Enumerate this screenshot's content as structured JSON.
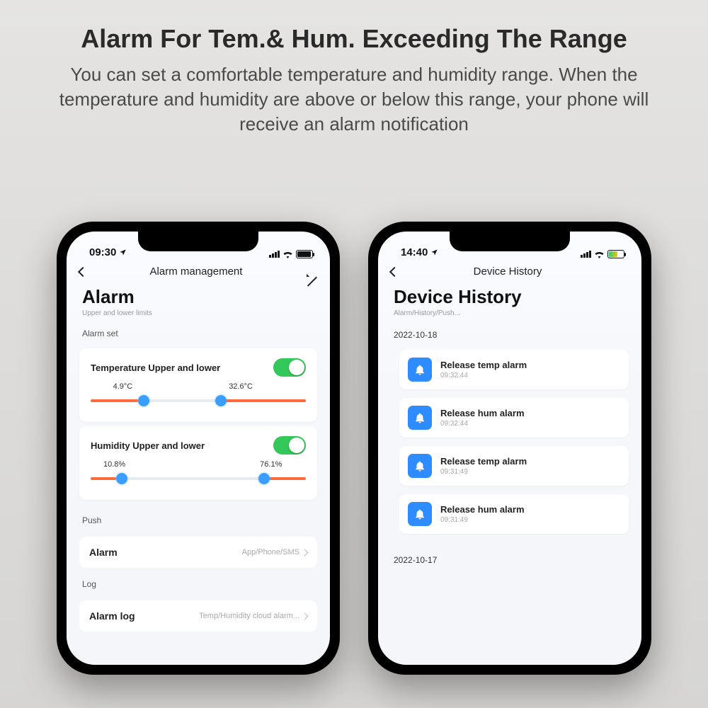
{
  "hero": {
    "title": "Alarm For Tem.& Hum. Exceeding The Range",
    "subtitle": "You can set a comfortable temperature and humidity range. When the temperature and humidity are above or below this range, your phone will receive an alarm notification"
  },
  "phone1": {
    "status_time": "09:30",
    "nav_title": "Alarm management",
    "page_title": "Alarm",
    "caption": "Upper and lower limits",
    "section_set": "Alarm set",
    "temp": {
      "label": "Temperature Upper and lower",
      "low": "4.9°C",
      "high": "32.6°C"
    },
    "hum": {
      "label": "Humidity Upper and lower",
      "low": "10.8%",
      "high": "76.1%"
    },
    "section_push": "Push",
    "push_row": {
      "label": "Alarm",
      "value": "App/Phone/SMS"
    },
    "section_log": "Log",
    "log_row": {
      "label": "Alarm log",
      "value": "Temp/Humidity cloud alarm..."
    }
  },
  "phone2": {
    "status_time": "14:40",
    "nav_title": "Device History",
    "page_title": "Device History",
    "caption": "Alarm/History/Push...",
    "groups": [
      {
        "date": "2022-10-18",
        "items": [
          {
            "title": "Release temp alarm",
            "time": "09:32:44"
          },
          {
            "title": "Release hum alarm",
            "time": "09:32:44"
          },
          {
            "title": "Release temp alarm",
            "time": "09:31:49"
          },
          {
            "title": "Release hum alarm",
            "time": "09:31:49"
          }
        ]
      },
      {
        "date": "2022-10-17",
        "items": []
      }
    ]
  }
}
